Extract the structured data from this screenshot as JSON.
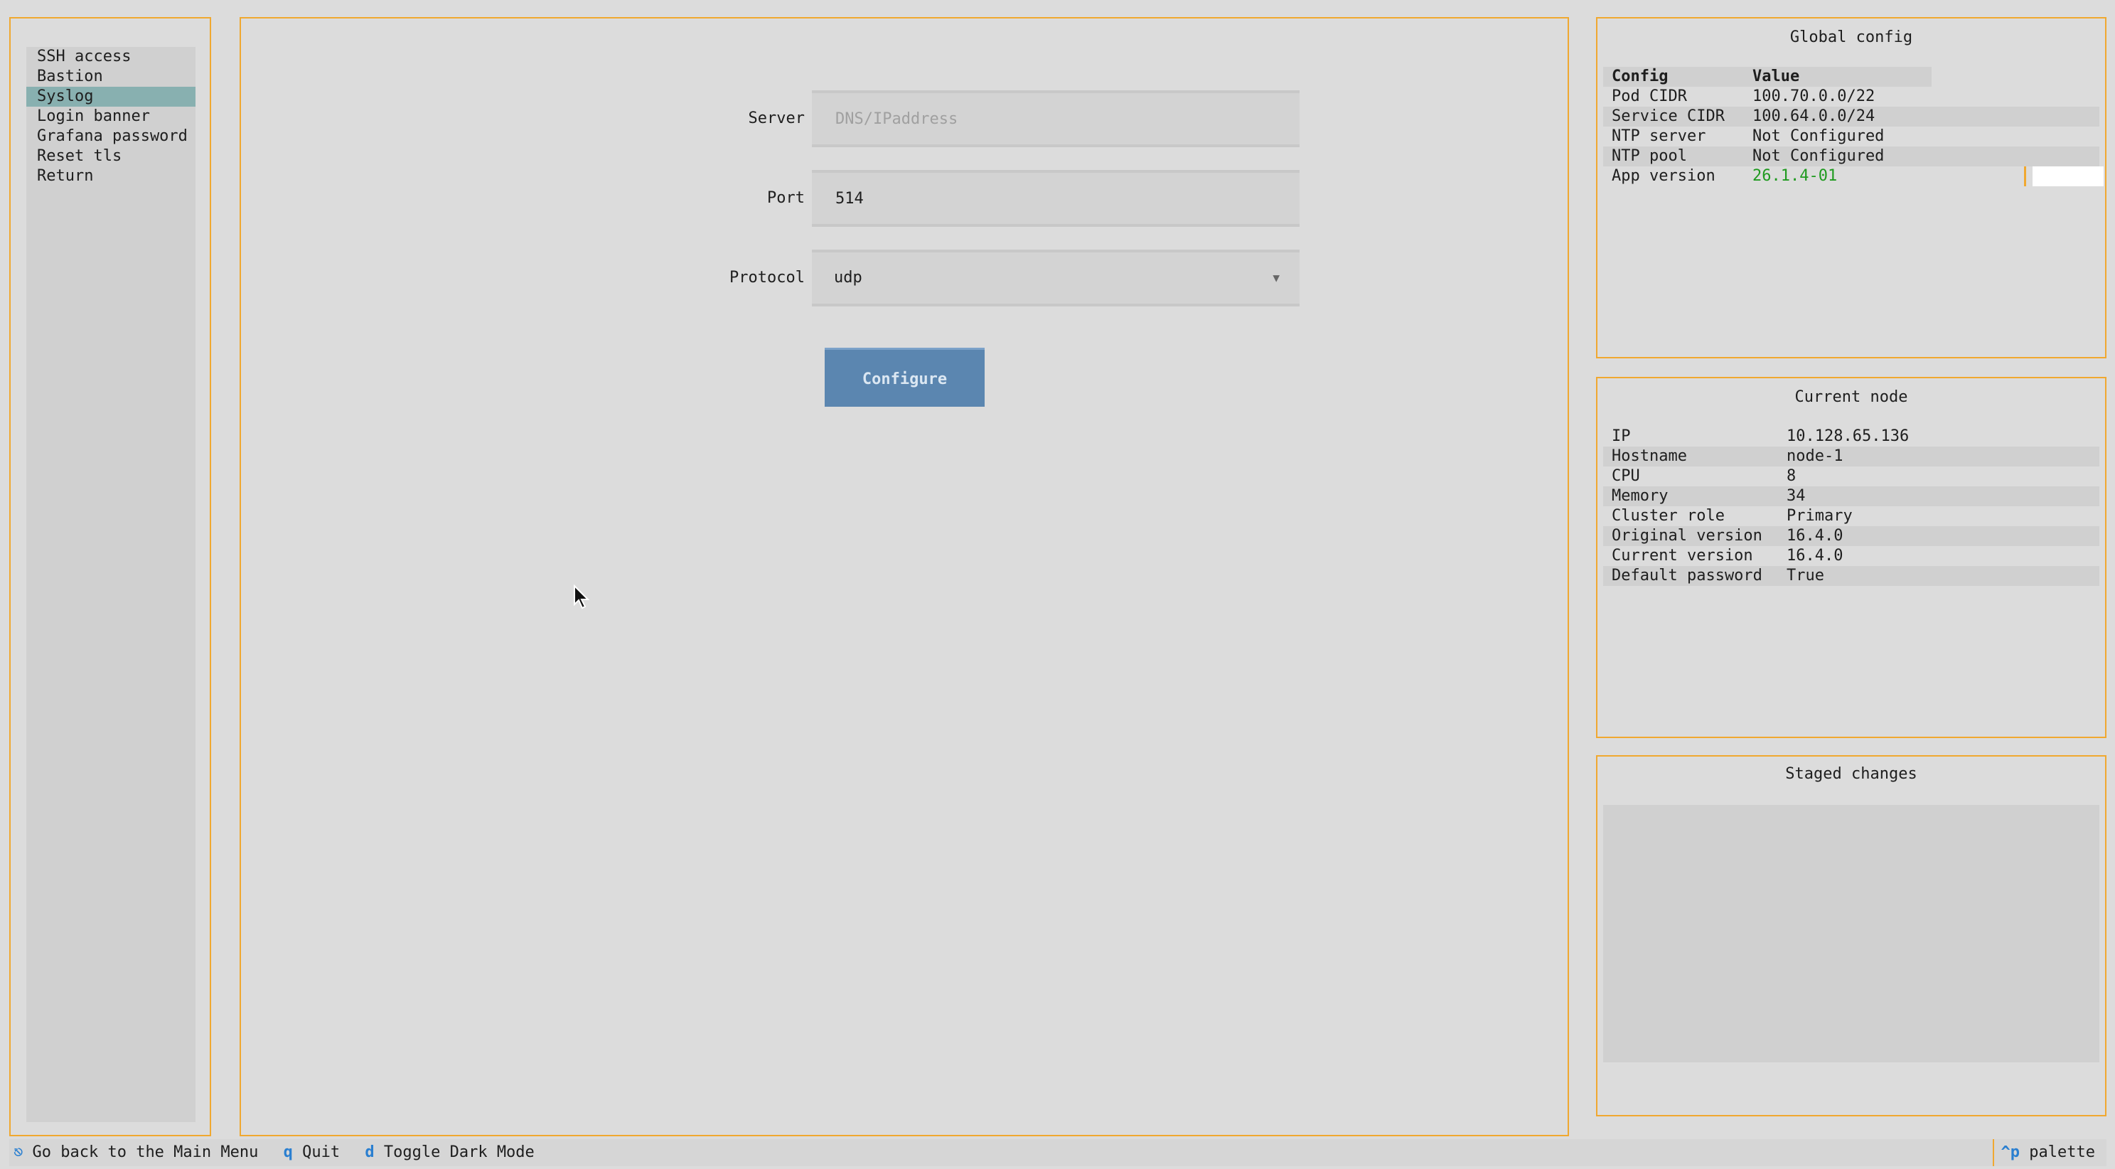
{
  "menu": {
    "items": [
      {
        "label": "SSH access"
      },
      {
        "label": "Bastion"
      },
      {
        "label": "Syslog",
        "selected": true
      },
      {
        "label": "Login banner"
      },
      {
        "label": "Grafana password"
      },
      {
        "label": "Reset tls"
      },
      {
        "label": "Return"
      }
    ]
  },
  "form": {
    "server_label": "Server",
    "server_placeholder": "DNS/IPaddress",
    "server_value": "",
    "port_label": "Port",
    "port_value": "514",
    "protocol_label": "Protocol",
    "protocol_value": "udp",
    "protocol_arrow": "▼",
    "configure_label": "Configure"
  },
  "global_config": {
    "title": "Global config",
    "header": {
      "key": "Config",
      "value": "Value"
    },
    "rows": [
      {
        "key": "Pod CIDR",
        "value": "100.70.0.0/22"
      },
      {
        "key": "Service CIDR",
        "value": "100.64.0.0/24"
      },
      {
        "key": "NTP server",
        "value": "Not Configured"
      },
      {
        "key": "NTP pool",
        "value": "Not Configured"
      },
      {
        "key": "App version",
        "value": "26.1.4-01"
      }
    ]
  },
  "current_node": {
    "title": "Current node",
    "rows": [
      {
        "key": "IP",
        "value": "10.128.65.136"
      },
      {
        "key": "Hostname",
        "value": "node-1"
      },
      {
        "key": "CPU",
        "value": "8"
      },
      {
        "key": "Memory",
        "value": "34"
      },
      {
        "key": "Cluster role",
        "value": "Primary"
      },
      {
        "key": "Original version",
        "value": "16.4.0"
      },
      {
        "key": "Current version",
        "value": "16.4.0"
      },
      {
        "key": "Default password",
        "value": "True"
      }
    ]
  },
  "staged": {
    "title": "Staged changes"
  },
  "footer": {
    "esc_key": "⎋",
    "esc_label": "Go back to the Main Menu",
    "quit_key": "q",
    "quit_label": "Quit",
    "dark_key": "d",
    "dark_label": "Toggle Dark Mode",
    "palette_key": "^p",
    "palette_label": "palette"
  },
  "colors": {
    "accent": "#f0a830",
    "selected": "#88b0b0",
    "button": "#5b86b0",
    "key": "#2a7fd0",
    "version": "#1f9a1f"
  }
}
